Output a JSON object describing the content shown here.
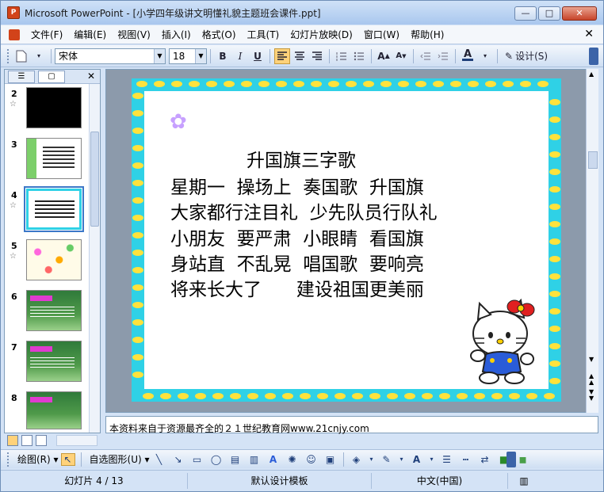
{
  "window": {
    "app_icon": "powerpoint-icon",
    "title": "Microsoft PowerPoint - [小学四年级讲文明懂礼貌主题班会课件.ppt]",
    "minimize": "—",
    "maximize": "□",
    "close": "✕"
  },
  "menu": {
    "items": [
      "文件(F)",
      "编辑(E)",
      "视图(V)",
      "插入(I)",
      "格式(O)",
      "工具(T)",
      "幻灯片放映(D)",
      "窗口(W)",
      "帮助(H)"
    ],
    "close": "✕"
  },
  "toolbar": {
    "font_name": "宋体",
    "font_size": "18",
    "bold": "B",
    "italic": "I",
    "underline": "U",
    "design_label": "设计(S)"
  },
  "slides_pane": {
    "tab_outline": "outline-tab-icon",
    "tab_slides": "slides-tab-icon",
    "close": "✕",
    "thumbnails": [
      {
        "number": "2",
        "star": "☆"
      },
      {
        "number": "3",
        "star": ""
      },
      {
        "number": "4",
        "star": "☆"
      },
      {
        "number": "5",
        "star": "☆"
      },
      {
        "number": "6",
        "star": ""
      },
      {
        "number": "7",
        "star": ""
      },
      {
        "number": "8",
        "star": ""
      }
    ]
  },
  "slide": {
    "title": "升国旗三字歌",
    "lines": [
      "星期一  操场上  奏国歌  升国旗",
      "大家都行注目礼  少先队员行队礼",
      "小朋友  要严肃  小眼睛  看国旗",
      "身站直  不乱晃  唱国歌  要响亮",
      "将来长大了      建设祖国更美丽"
    ]
  },
  "notes": {
    "text": "本资料来自于资源最齐全的２１世纪教育网www.21cnjy.com"
  },
  "drawing_toolbar": {
    "draw_label": "绘图(R)",
    "autoshapes_label": "自选图形(U)"
  },
  "status": {
    "slide_position": "幻灯片 4 / 13",
    "template": "默认设计模板",
    "language": "中文(中国)"
  },
  "colors": {
    "border_cyan": "#2fd1e6",
    "border_yellow": "#ffe23c",
    "selection": "#3c78c8"
  }
}
